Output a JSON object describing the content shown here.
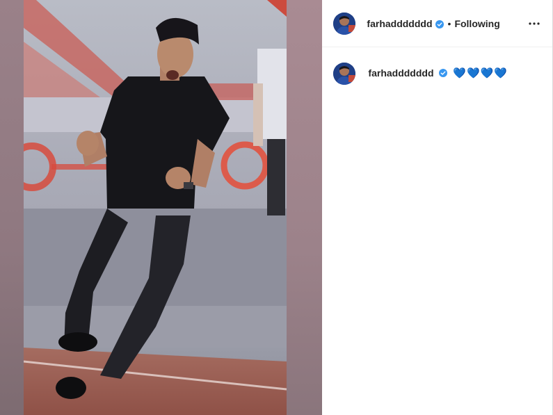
{
  "post": {
    "username": "farhaddddddd",
    "separator": "•",
    "follow_status": "Following",
    "more_icon": "more-horizontal-icon",
    "caption_text": "💙💙💙💙",
    "accent_color": "#3897f0",
    "heart_color": "#1d8fe8"
  }
}
